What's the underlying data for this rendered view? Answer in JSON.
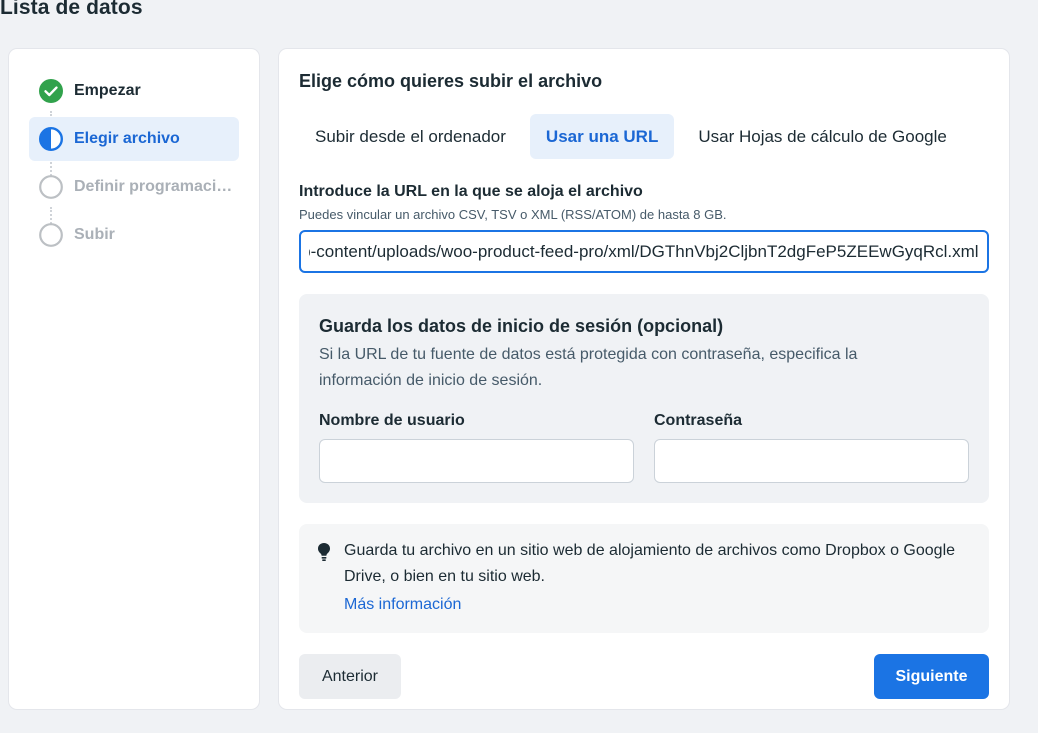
{
  "page": {
    "title": "Lista de datos"
  },
  "steps": [
    {
      "label": "Empezar",
      "status": "done",
      "icon": "check-circle-icon"
    },
    {
      "label": "Elegir archivo",
      "status": "active",
      "icon": "half-circle-icon"
    },
    {
      "label": "Definir programación",
      "status": "pending",
      "icon": "empty-circle-icon"
    },
    {
      "label": "Subir",
      "status": "pending",
      "icon": "empty-circle-icon"
    }
  ],
  "main": {
    "heading": "Elige cómo quieres subir el archivo",
    "tabs": [
      {
        "label": "Subir desde el ordenador",
        "selected": false
      },
      {
        "label": "Usar una URL",
        "selected": true
      },
      {
        "label": "Usar Hojas de cálculo de Google",
        "selected": false
      }
    ],
    "url_field": {
      "label": "Introduce la URL en la que se aloja el archivo",
      "help": "Puedes vincular un archivo CSV, TSV o XML (RSS/ATOM) de hasta 8 GB.",
      "value": "https://example.com/wp-content/uploads/woo-product-feed-pro/xml/DGThnVbj2CljbnT2dgFeP5ZEEwGyqRcl.xml"
    },
    "login": {
      "title": "Guarda los datos de inicio de sesión (opcional)",
      "description": "Si la URL de tu fuente de datos está protegida con contraseña, especifica la información de inicio de sesión.",
      "username_label": "Nombre de usuario",
      "username_value": "",
      "password_label": "Contraseña",
      "password_value": ""
    },
    "tip": {
      "icon": "lightbulb-icon",
      "text": "Guarda tu archivo en un sitio web de alojamiento de archivos como Dropbox o Google Drive, o bien en tu sitio web.",
      "link": "Más información"
    },
    "buttons": {
      "previous": "Anterior",
      "next": "Siguiente"
    }
  },
  "colors": {
    "accent": "#1b74e4",
    "accent_text": "#1b67d4",
    "active_bg": "#e7f0fb",
    "done_green": "#31a24c",
    "background": "#f0f2f5"
  }
}
